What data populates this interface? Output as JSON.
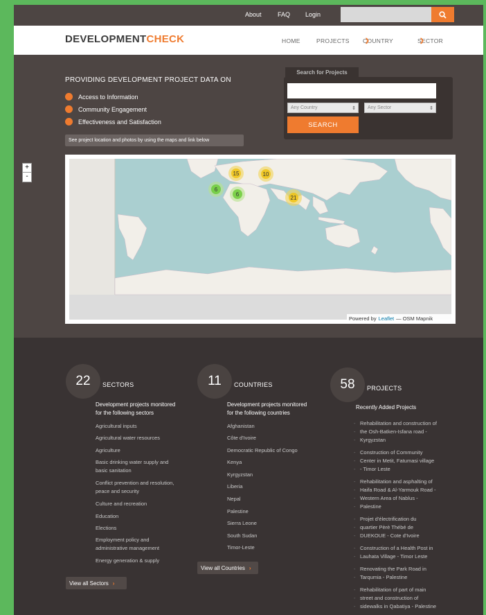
{
  "topbar": {
    "links": [
      "About",
      "FAQ",
      "Login"
    ],
    "search_placeholder": ""
  },
  "header": {
    "logo_part1": "DEVELOPMENT",
    "logo_part2": "CHECK",
    "nav": [
      "HOME",
      "PROJECTS",
      "COUNTRY",
      "SECTOR"
    ]
  },
  "hero": {
    "title": "PROVIDING DEVELOPMENT PROJECT DATA ON",
    "bullets": [
      "Access to Information",
      "Community Engagement",
      "Effectiveness and Satisfaction"
    ],
    "map_hint": "See project location and photos by using the maps and link below"
  },
  "search": {
    "tab_label": "Search for Projects",
    "country_select": "Any Country",
    "sector_select": "Any Sector",
    "button": "SEARCH"
  },
  "map": {
    "zoom_in": "+",
    "zoom_out": "-",
    "clusters": [
      {
        "count": "15",
        "color": "yellow"
      },
      {
        "count": "10",
        "color": "yellow"
      },
      {
        "count": "6",
        "color": "green"
      },
      {
        "count": "6",
        "color": "green"
      },
      {
        "count": "21",
        "color": "yellow"
      }
    ],
    "attribution_prefix": "Powered by",
    "attribution_link": "Leaflet",
    "attribution_suffix": "— OSM Mapnik"
  },
  "sectors": {
    "count": "22",
    "label": "SECTORS",
    "desc_line1": "Development projects monitored",
    "desc_line2": "for the following sectors",
    "items": [
      "Agricultural inputs",
      "Agricultural water resources",
      "Agriculture",
      "Basic drinking water supply and",
      "basic sanitation",
      "Conflict prevention and resolution,",
      "peace and security",
      "Culture and recreation",
      "Education",
      "Elections",
      "Employment policy and",
      "administrative management",
      "Energy generation & supply"
    ],
    "view_all": "View all Sectors"
  },
  "countries": {
    "count": "11",
    "label": "COUNTRIES",
    "desc_line1": "Development projects monitored",
    "desc_line2": "for the following countries",
    "items": [
      "Afghanistan",
      "Côte d'Ivoire",
      "Democratic Republic of Congo",
      "Kenya",
      "Kyrgyzstan",
      "Liberia",
      "Nepal",
      "Palestine",
      "Sierra Leone",
      "South Sudan",
      "Timor-Leste"
    ],
    "view_all": "View all Countries"
  },
  "projects": {
    "count": "58",
    "label": "PROJECTS",
    "recent_title": "Recently Added Projects",
    "items": [
      "Rehabilitation and construction of",
      "the Osh-Batken-Isfana road -",
      "Kyrgyzstan",
      "Construction of Community",
      "Center in Metit, Fatumasi village",
      "- Timor Leste",
      "Rehabilitation and asphalting of",
      "Haifa Road & Al-Yarmouk Road -",
      "Western Area of Nablus -",
      "Palestine",
      "Projet d'électrification du",
      "quartier Pèrè Thébé de",
      "DUEKOUE - Cote d'Ivoire",
      "Construction of a Health Post in",
      "Lauhata Village - Timor Leste",
      "Renovating the Park Road in",
      "Tarqumia - Palestine",
      "Rehabilitation of part of main",
      "street and construction of",
      "sidewalks in Qabatiya - Palestine"
    ]
  }
}
